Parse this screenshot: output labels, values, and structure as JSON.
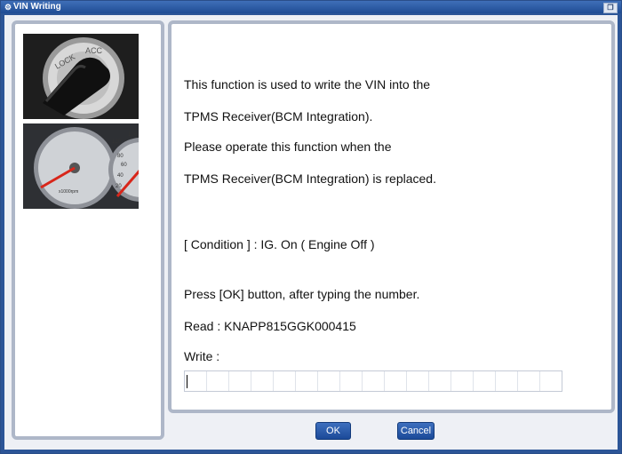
{
  "window": {
    "title": "VIN Writing",
    "title_icon": "gear-icon",
    "control_icon": "restore-icon"
  },
  "images": [
    {
      "name": "ignition-switch-image",
      "icon": "ignition-key-icon",
      "labels": [
        "LOCK",
        "ACC"
      ]
    },
    {
      "name": "instrument-cluster-image",
      "icon": "gauge-cluster-icon",
      "labels": [
        "x1000rpm",
        "120",
        "100",
        "80",
        "60",
        "40",
        "20"
      ]
    }
  ],
  "message": {
    "line1": "This function is used to write the VIN into the",
    "line2": "TPMS Receiver(BCM Integration).",
    "line3": "Please operate this function when the",
    "line4": "TPMS Receiver(BCM Integration) is replaced.",
    "condition": "[ Condition ] : IG. On ( Engine Off )",
    "instruction": "Press [OK] button, after typing the number.",
    "read": "Read : KNAPP815GGK000415",
    "write_label": "Write :"
  },
  "write_field": {
    "value": "",
    "cells": 17
  },
  "buttons": {
    "ok": "OK",
    "cancel": "Cancel"
  },
  "colors": {
    "title_bar": "#1f4c94",
    "panel_border": "#aeb7c8",
    "button": "#1b4a99"
  }
}
